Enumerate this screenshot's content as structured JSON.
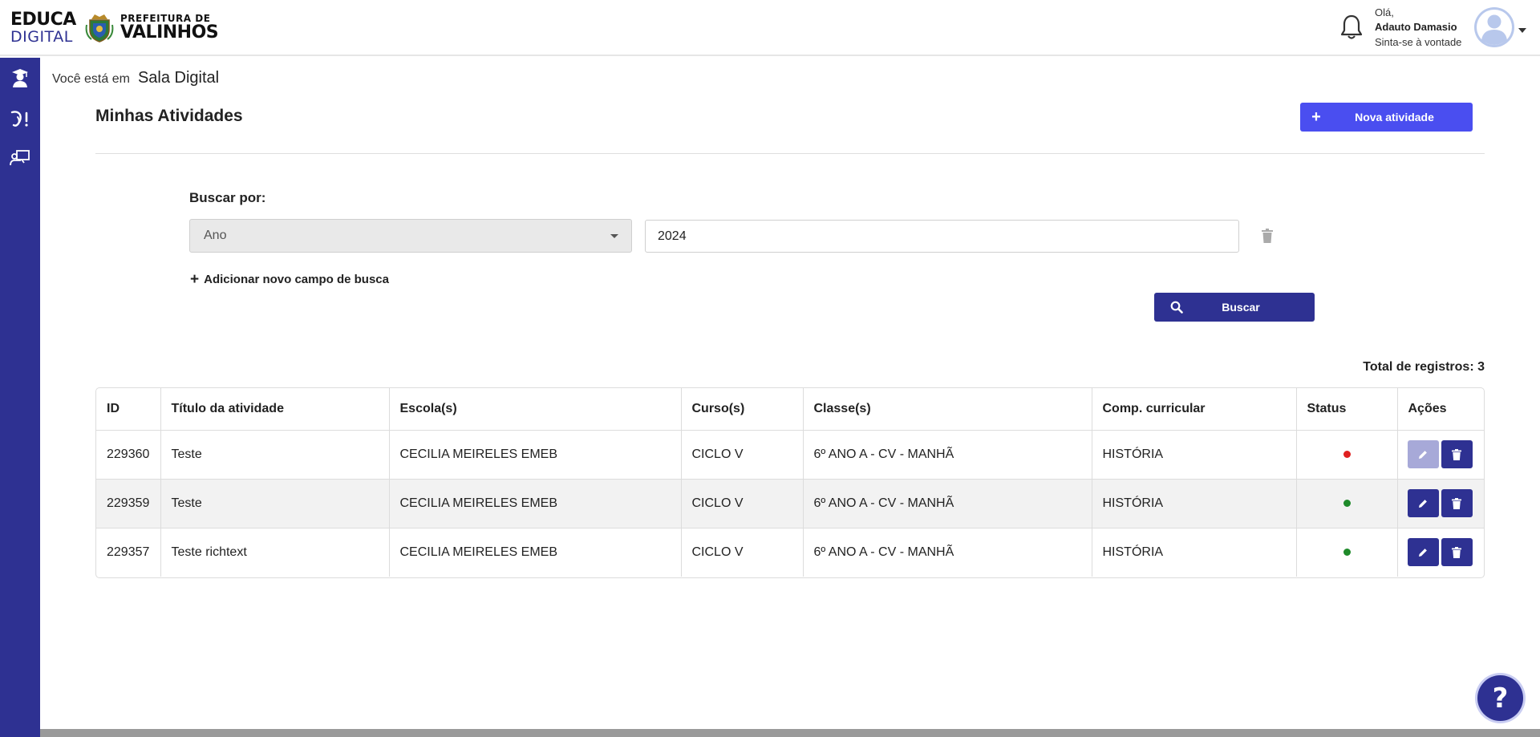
{
  "header": {
    "logo_educa_line1": "EDUCA",
    "logo_educa_line2": "DIGITAL",
    "logo_city_line1": "PREFEITURA DE",
    "logo_city_line2": "VALINHOS",
    "greeting": "Olá,",
    "user_name": "Adauto Damasio",
    "welcome": "Sinta-se à vontade",
    "icons": [
      "bell-icon",
      "avatar-icon",
      "chevron-down-icon"
    ]
  },
  "sidebar": {
    "items": [
      {
        "icon": "graduation-icon"
      },
      {
        "icon": "activity-icon"
      },
      {
        "icon": "teacher-board-icon"
      }
    ]
  },
  "breadcrumb": {
    "prefix": "Você está em",
    "current": "Sala Digital"
  },
  "page": {
    "title": "Minhas Atividades",
    "new_button_label": "Nova atividade"
  },
  "search": {
    "label": "Buscar por:",
    "field_select_value": "Ano",
    "field_value": "2024",
    "add_field_label": "Adicionar novo campo de busca",
    "search_button_label": "Buscar"
  },
  "results": {
    "total_label": "Total de registros: 3",
    "columns": [
      "ID",
      "Título da atividade",
      "Escola(s)",
      "Curso(s)",
      "Classe(s)",
      "Comp. curricular",
      "Status",
      "Ações"
    ],
    "rows": [
      {
        "id": "229360",
        "title": "Teste",
        "school": "CECILIA MEIRELES EMEB",
        "course": "CICLO V",
        "class": "6º ANO A - CV - MANHÃ",
        "subject": "HISTÓRIA",
        "status_color": "#e02020",
        "edit_enabled": false
      },
      {
        "id": "229359",
        "title": "Teste",
        "school": "CECILIA MEIRELES EMEB",
        "course": "CICLO V",
        "class": "6º ANO A - CV - MANHÃ",
        "subject": "HISTÓRIA",
        "status_color": "#1f8a2a",
        "edit_enabled": true
      },
      {
        "id": "229357",
        "title": "Teste richtext",
        "school": "CECILIA MEIRELES EMEB",
        "course": "CICLO V",
        "class": "6º ANO A - CV - MANHÃ",
        "subject": "HISTÓRIA",
        "status_color": "#1f8a2a",
        "edit_enabled": true
      }
    ]
  },
  "help": {
    "label": "?"
  },
  "colors": {
    "primary": "#2e3192",
    "accent": "#4a4ef0",
    "disabled": "#a7a9d8"
  }
}
